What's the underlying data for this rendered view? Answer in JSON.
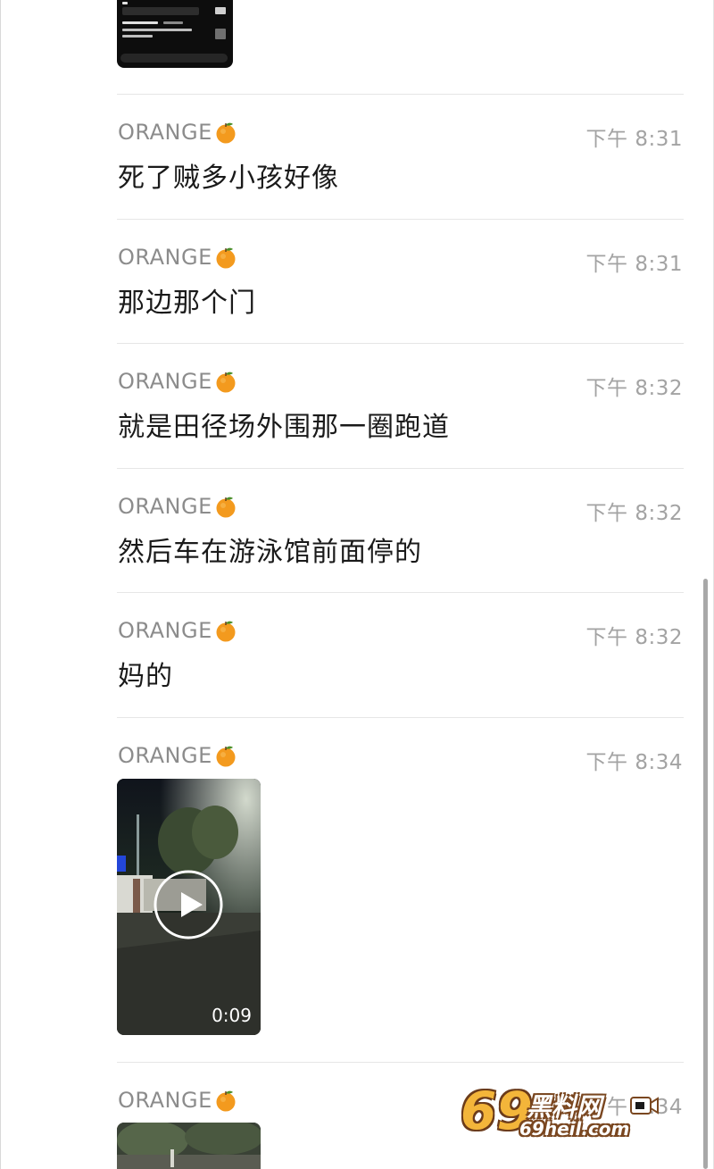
{
  "chat": {
    "sender_name": "ORANGE",
    "messages": [
      {
        "kind": "text",
        "time": "下午 8:31",
        "text": "死了贼多小孩好像"
      },
      {
        "kind": "text",
        "time": "下午 8:31",
        "text": "那边那个门"
      },
      {
        "kind": "text",
        "time": "下午 8:32",
        "text": "就是田径场外围那一圈跑道"
      },
      {
        "kind": "text",
        "time": "下午 8:32",
        "text": "然后车在游泳馆前面停的"
      },
      {
        "kind": "text",
        "time": "下午 8:32",
        "text": "妈的"
      },
      {
        "kind": "video",
        "time": "下午 8:34",
        "duration": "0:09"
      },
      {
        "kind": "video",
        "time": "下午 8:34"
      }
    ]
  },
  "watermark": {
    "logo_number": "69",
    "logo_text": "黑料网",
    "logo_url": "69heil.com"
  },
  "icons": {
    "sender_badge": "orange-fruit-icon",
    "video_play": "play-icon",
    "watermark_camera": "video-camera-icon"
  },
  "colors": {
    "background": "#ffffff",
    "sender_text": "#8c8c8c",
    "time_text": "#a3a3a3",
    "message_text": "#1a1a1a",
    "divider": "#e6e6e6",
    "orange": "#f39a1e"
  }
}
